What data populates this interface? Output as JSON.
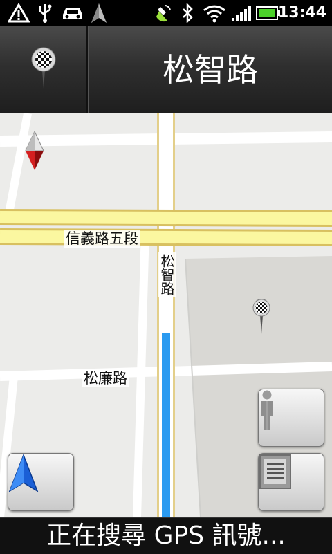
{
  "status_bar": {
    "time": "13:44",
    "icons": [
      "warning-icon",
      "usb-icon",
      "car-mode-icon",
      "navigation-icon",
      "gps-searching-icon",
      "bluetooth-icon",
      "wifi-icon",
      "signal-icon",
      "battery-icon"
    ],
    "battery_color": "#4cd12a"
  },
  "header": {
    "current_street": "松智路",
    "destination_icon": "checkered-flag-pin-icon"
  },
  "map": {
    "roads": {
      "xinyi": "信義路五段",
      "songzhi": "松智路",
      "songlian": "松廉路"
    },
    "route_color": "#2a9af0"
  },
  "buttons": {
    "street_view_icon": "street-view-person-icon",
    "menu_icon": "list-menu-icon",
    "my_location_icon": "navigation-arrow-icon"
  },
  "status_message": "正在搜尋 GPS 訊號..."
}
